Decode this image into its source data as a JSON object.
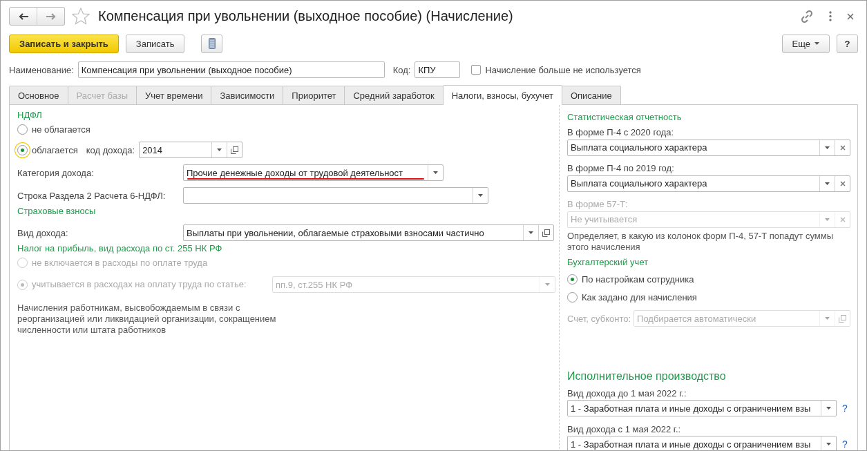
{
  "window": {
    "title": "Компенсация при увольнении (выходное пособие) (Начисление)"
  },
  "toolbar": {
    "buttons": [
      {
        "label": "Записать и закрыть",
        "kind": "primary"
      },
      {
        "label": "Записать",
        "kind": "normal"
      }
    ],
    "more": "Еще",
    "help": "?"
  },
  "header": {
    "name_label": "Наименование:",
    "name_value": "Компенсация при увольнении (выходное пособие)",
    "code_label": "Код:",
    "code_value": "КПУ",
    "unused": {
      "label": "Начисление больше не используется",
      "checked": false
    }
  },
  "tabs": [
    {
      "label": "Основное",
      "selected": false,
      "disabled": false
    },
    {
      "label": "Расчет базы",
      "selected": false,
      "disabled": true
    },
    {
      "label": "Учет времени",
      "selected": false,
      "disabled": false
    },
    {
      "label": "Зависимости",
      "selected": false,
      "disabled": false
    },
    {
      "label": "Приоритет",
      "selected": false,
      "disabled": false
    },
    {
      "label": "Средний заработок",
      "selected": false,
      "disabled": false
    },
    {
      "label": "Налоги, взносы, бухучет",
      "selected": true,
      "disabled": false
    },
    {
      "label": "Описание",
      "selected": false,
      "disabled": false
    }
  ],
  "left": {
    "rows": [
      {
        "kind": "heading",
        "text": "НДФЛ"
      },
      {
        "kind": "radio",
        "label": "не облагается",
        "selected": false,
        "disabled": false
      },
      {
        "kind": "radio_field",
        "label": "облагается",
        "selected": true,
        "disabled": false,
        "focused": true,
        "field_label": "код дохода:",
        "value": "2014",
        "buttons": [
          {
            "kind": "dropdown"
          },
          {
            "kind": "open"
          }
        ]
      },
      {
        "kind": "field",
        "label": "Категория дохода:",
        "value": "Прочие денежные доходы от трудовой деятельност",
        "buttons": [
          {
            "kind": "dropdown"
          }
        ],
        "underlined": true
      },
      {
        "kind": "field",
        "label": "Строка Раздела 2 Расчета 6-НДФЛ:",
        "buttons": [
          {
            "kind": "dropdown"
          }
        ]
      },
      {
        "kind": "heading",
        "text": "Страховые взносы"
      },
      {
        "kind": "field",
        "label": "Вид дохода:",
        "value": "Выплаты при увольнении, облагаемые страховыми взносами частично",
        "buttons": [
          {
            "kind": "dropdown"
          },
          {
            "kind": "open"
          }
        ]
      },
      {
        "kind": "heading",
        "text": "Налог на прибыль, вид расхода по ст. 255 НК РФ"
      },
      {
        "kind": "radio",
        "label": "не включается в расходы по оплате труда",
        "selected": false,
        "disabled": true
      },
      {
        "kind": "radio_field",
        "label": "учитывается в расходах на оплату труда по статье:",
        "selected": true,
        "disabled": true,
        "value": "пп.9, ст.255 НК РФ",
        "buttons": [
          {
            "kind": "dropdown"
          }
        ]
      },
      {
        "kind": "note",
        "text": "Начисления работникам, высвобождаемым в связи с реорганизацией или ликвидацией организации, сокращением численности или штата работников"
      }
    ]
  },
  "right": {
    "rows": [
      {
        "kind": "heading",
        "text": "Статистическая отчетность"
      },
      {
        "kind": "stacked_field",
        "label": "В форме П-4 с 2020 года:",
        "value": "Выплата социального характера",
        "disabled": false,
        "buttons": [
          {
            "kind": "dropdown"
          },
          {
            "kind": "clear"
          }
        ]
      },
      {
        "kind": "stacked_field",
        "label": "В форме П-4 по 2019 год:",
        "value": "Выплата социального характера",
        "disabled": false,
        "buttons": [
          {
            "kind": "dropdown"
          },
          {
            "kind": "clear"
          }
        ]
      },
      {
        "kind": "stacked_field",
        "label": "В форме 57-Т:",
        "value": "Не учитывается",
        "disabled": true,
        "buttons": [
          {
            "kind": "dropdown"
          },
          {
            "kind": "clear"
          }
        ]
      },
      {
        "kind": "note",
        "text": "Определяет, в какую из колонок форм П-4, 57-Т попадут суммы этого начисления"
      },
      {
        "kind": "heading",
        "text": "Бухгалтерский учет"
      },
      {
        "kind": "radio",
        "label": "По настройкам сотрудника",
        "selected": true,
        "disabled": false
      },
      {
        "kind": "radio",
        "label": "Как задано для начисления",
        "selected": false,
        "disabled": false
      },
      {
        "kind": "field",
        "label": "Счет, субконто:",
        "placeholder": "Подбирается автоматически",
        "disabled": true,
        "buttons": [
          {
            "kind": "dropdown"
          },
          {
            "kind": "open"
          }
        ]
      },
      {
        "kind": "heading",
        "text": "Исполнительное производство",
        "large": true
      },
      {
        "kind": "stacked_field",
        "label": "Вид дохода до 1 мая 2022 г.:",
        "value": "1 - Заработная плата и иные доходы с ограничением взы",
        "disabled": false,
        "buttons": [
          {
            "kind": "dropdown"
          }
        ],
        "help": "?"
      },
      {
        "kind": "stacked_field",
        "label": "Вид дохода с 1 мая 2022 г.:",
        "value": "1 - Заработная плата и иные доходы с ограничением взы",
        "disabled": false,
        "buttons": [
          {
            "kind": "dropdown"
          }
        ],
        "help": "?"
      }
    ]
  }
}
